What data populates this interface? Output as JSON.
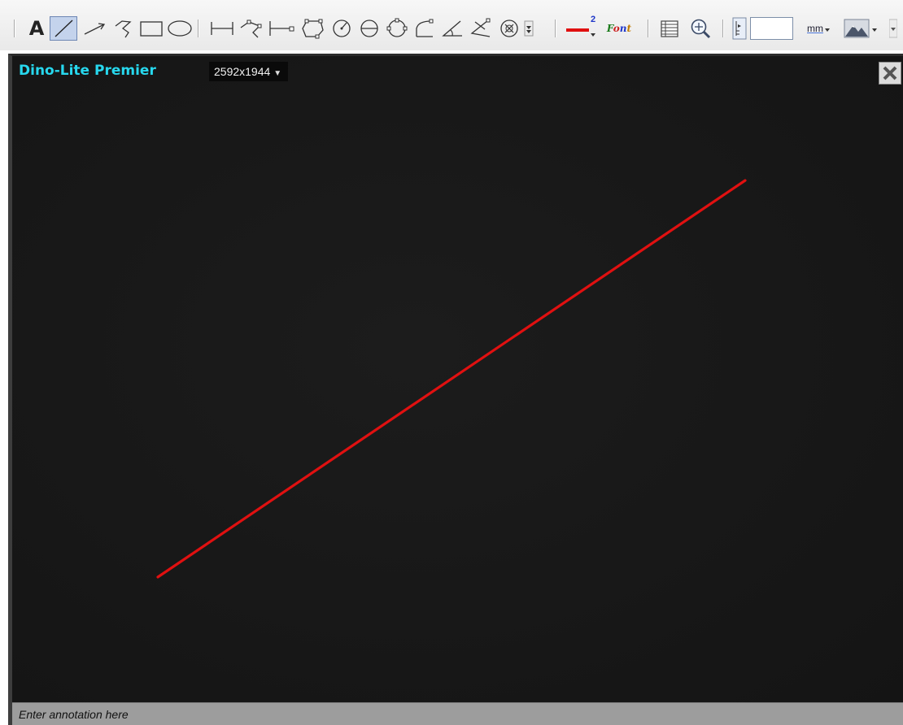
{
  "toolbar": {
    "text_tool_glyph": "A",
    "font_label": "Font",
    "line_width": "2",
    "unit_label": "mm",
    "field_value": "",
    "tools": [
      "text-icon",
      "straight-line-icon",
      "arrow-icon",
      "polyline-icon",
      "rectangle-icon",
      "ellipse-icon",
      "distance-icon",
      "angle-polyline-icon",
      "parallel-line-icon",
      "polygon-icon",
      "circle-radius-icon",
      "circle-diameter-icon",
      "three-point-circle-icon",
      "arc-icon",
      "angle-icon",
      "four-point-angle-icon",
      "center-circle-icon",
      "more-dropdown-icon",
      "line-color-icon",
      "font-icon",
      "table-icon",
      "zoom-icon",
      "calibration-icon",
      "unit-dropdown-icon",
      "mountain-icon"
    ],
    "colors": {
      "line_color": "#e01010",
      "font_f": "#1a7a1a",
      "font_o": "#c22",
      "font_n": "#1f36c8",
      "font_t": "#c07a00"
    }
  },
  "camera": {
    "title": "Dino-Lite Premier",
    "resolution": "2592x1944",
    "title_color": "#27d8ee",
    "background_color": "#151515"
  },
  "measurement_line": {
    "color": "#e01010"
  },
  "annotation": {
    "placeholder": "Enter annotation here",
    "value": ""
  }
}
